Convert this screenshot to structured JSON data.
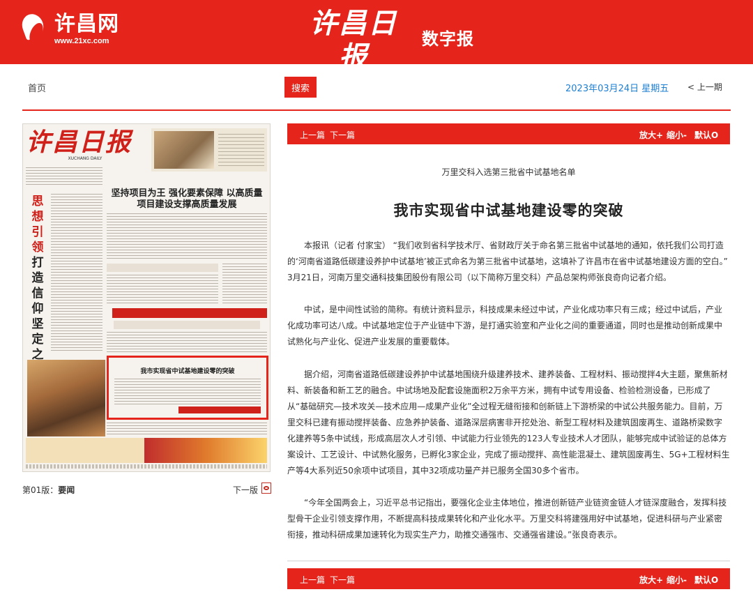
{
  "header": {
    "site_name": "许昌网",
    "site_url": "www.21xc.com",
    "paper_name": "许昌日报",
    "paper_name_en": "XUCHANG DAILY",
    "digital_label": "数字报"
  },
  "nav": {
    "home_label": "首页",
    "search_placeholder": "",
    "search_button": "搜索",
    "date": "2023年03月24日  星期五",
    "prev_issue": "< 上一期"
  },
  "page_panel": {
    "thumbnail_headline": "坚持项目为王 强化要素保障 以高质量项目建设支撑高质量发展",
    "thumbnail_vertical_red": "思想引领",
    "thumbnail_vertical_black": "打造信仰坚定之城",
    "thumbnail_selected_title": "我市实现省中试基地建设零的突破",
    "page_label_prefix": "第01版：",
    "page_label_name": "要闻",
    "next_page": "下一版"
  },
  "toolbar": {
    "prev_article": "上一篇",
    "next_article": "下一篇",
    "zoom_in": "放大+",
    "zoom_out": "缩小-",
    "reset": "默认O"
  },
  "article": {
    "subtitle": "万里交科入选第三批省中试基地名单",
    "title": "我市实现省中试基地建设零的突破",
    "paragraphs": [
      "本报讯（记者 付家宝） “我们收到省科学技术厅、省财政厅关于命名第三批省中试基地的通知，依托我们公司打造的‘河南省道路低碳建设养护中试基地’被正式命名为第三批省中试基地，这填补了许昌市在省中试基地建设方面的空白。” 3月21日，河南万里交通科技集团股份有限公司（以下简称万里交科）产品总架构师张良奇向记者介绍。",
      "中试，是中间性试验的简称。有统计资料显示，科技成果未经过中试，产业化成功率只有三成；经过中试后，产业化成功率可达八成。中试基地定位于产业链中下游，是打通实验室和产业化之间的重要通道，同时也是推动创新成果中试熟化与产业化、促进产业发展的重要载体。",
      "据介绍，河南省道路低碳建设养护中试基地围绕升级建养技术、建养装备、工程材料、振动搅拌4大主题，聚焦新材料、新装备和新工艺的融合。中试场地及配套设施面积2万余平方米，拥有中试专用设备、检验检测设备，已形成了从“基础研究—技术攻关—技术应用—成果产业化”全过程无缝衔接和创新链上下游桥梁的中试公共服务能力。目前，万里交科已建有振动搅拌装备、应急养护装备、道路深层病害非开挖处治、新型工程材料及建筑固废再生、道路桥梁数字化建养等5条中试线，形成高层次人才引领、中试能力行业领先的123人专业技术人才团队，能够完成中试验证的总体方案设计、工艺设计、中试熟化服务，已孵化3家企业，完成了振动搅拌、高性能混凝土、建筑固废再生、5G+工程材料生产等4大系列近50余项中试项目，其中32项成功量产并已服务全国30多个省市。",
      "“今年全国两会上，习近平总书记指出，要强化企业主体地位，推进创新链产业链资金链人才链深度融合，发挥科技型骨干企业引领支撑作用，不断提高科技成果转化和产业化水平。万里交科将建强用好中试基地，促进科研与产业紧密衔接，推动科研成果加速转化为现实生产力，助推交通强市、交通强省建设。”张良奇表示。"
    ]
  },
  "colors": {
    "brand_red": "#e5251b",
    "date_blue": "#1e7fd1"
  }
}
